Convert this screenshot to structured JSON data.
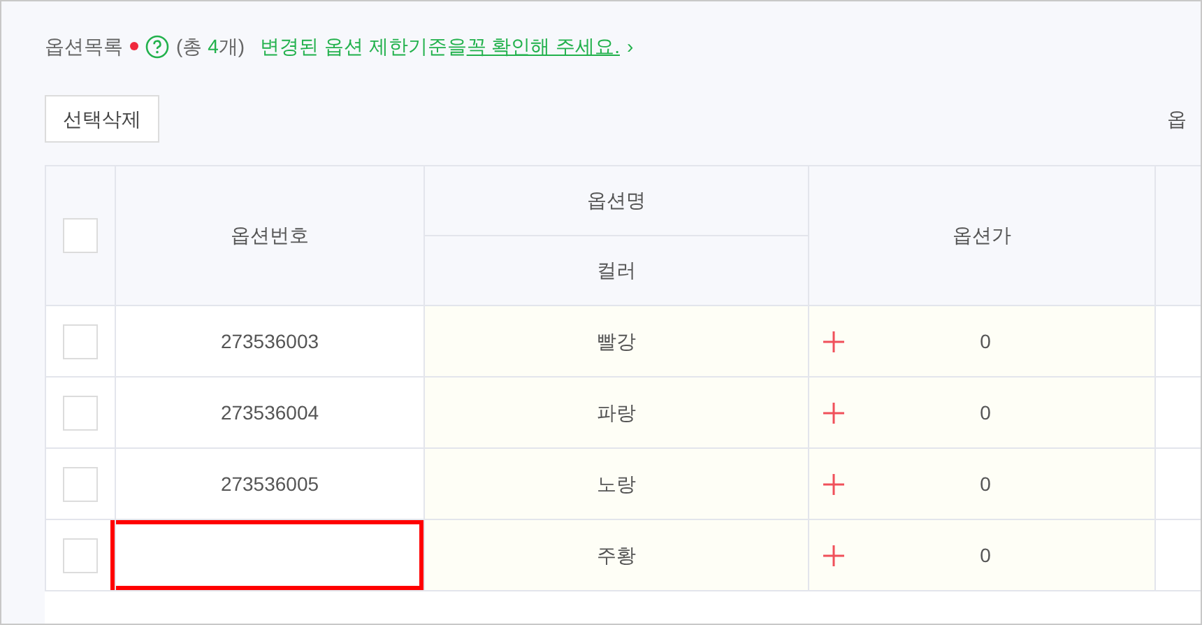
{
  "header": {
    "title": "옵션목록",
    "required": true,
    "total_prefix": "(총 ",
    "total_count": "4",
    "total_suffix": "개)",
    "notice": "변경된 옵션 제한기준을 ",
    "notice_link": "꼭 확인해 주세요.",
    "notice_arrow": "›"
  },
  "toolbar": {
    "delete_button": "선택삭제",
    "right_label": "옵"
  },
  "table": {
    "select_all_checked": false,
    "columns": {
      "number": "옵션번호",
      "name_group": "옵션명",
      "name_sub": "컬러",
      "price": "옵션가"
    },
    "rows": [
      {
        "checked": false,
        "number": "273536003",
        "name": "빨강",
        "price": "0",
        "highlighted": false
      },
      {
        "checked": false,
        "number": "273536004",
        "name": "파랑",
        "price": "0",
        "highlighted": false
      },
      {
        "checked": false,
        "number": "273536005",
        "name": "노랑",
        "price": "0",
        "highlighted": false
      },
      {
        "checked": false,
        "name": "주황",
        "price": "0",
        "highlighted": true
      }
    ]
  }
}
